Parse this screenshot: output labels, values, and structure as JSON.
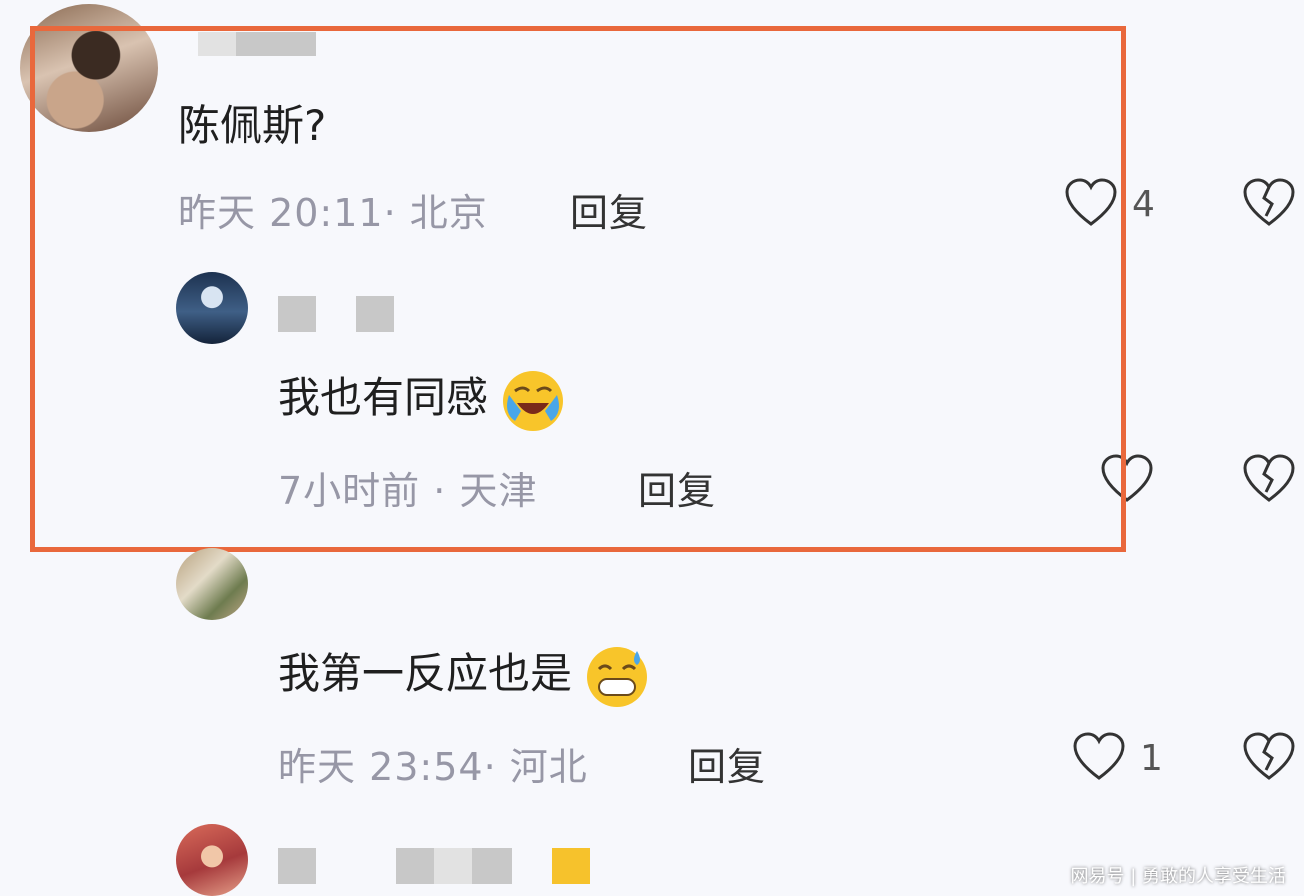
{
  "comments": [
    {
      "text": "陈佩斯?",
      "time": "昨天 20:11",
      "location": "北京",
      "meta_sep": "· ",
      "reply_label": "回复",
      "likes": "4"
    },
    {
      "text": "我也有同感",
      "emoji": "crying-laughing-emoji",
      "time": "7小时前",
      "location": "天津",
      "meta_sep": " · ",
      "reply_label": "回复",
      "likes": ""
    },
    {
      "text": "我第一反应也是",
      "emoji": "grinning-sweat-emoji",
      "time": "昨天 23:54",
      "location": "河北",
      "meta_sep": "· ",
      "reply_label": "回复",
      "likes": "1"
    }
  ],
  "icons": {
    "like": "heart-outline-icon",
    "dislike": "broken-heart-icon"
  },
  "colors": {
    "highlight_border": "#e9683c",
    "meta_text": "#9797a6",
    "background": "#f7f8fc"
  },
  "watermark": "网易号 | 勇敢的人享受生活"
}
